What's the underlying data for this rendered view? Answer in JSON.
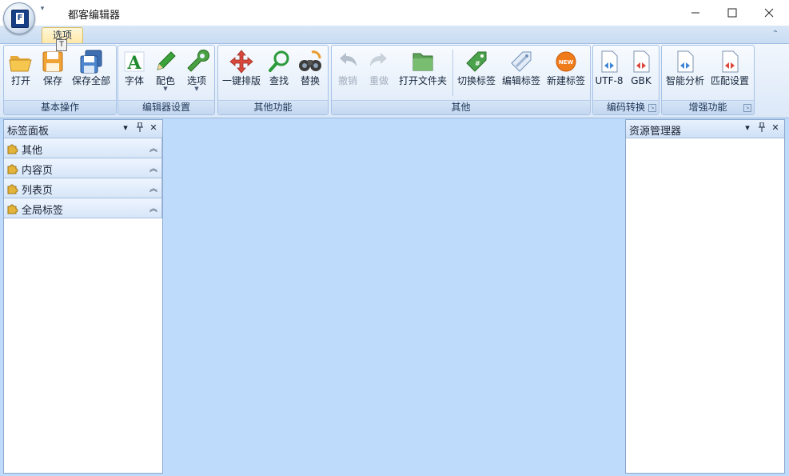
{
  "window": {
    "title": "都客编辑器",
    "minimize_glyph": "—",
    "maximize_glyph": "☐",
    "close_glyph": "✕",
    "app_icon_letter": "F"
  },
  "quick_access": {
    "customize_glyph": "▾"
  },
  "ribbon": {
    "active_tab": "选项",
    "key_tip": "T",
    "collapse_glyph": "⌃",
    "groups": [
      {
        "label": "基本操作",
        "buttons": [
          {
            "label": "打开",
            "icon": "folder-open-icon"
          },
          {
            "label": "保存",
            "icon": "save-icon"
          },
          {
            "label": "保存全部",
            "icon": "save-all-icon"
          }
        ]
      },
      {
        "label": "编辑器设置",
        "buttons": [
          {
            "label": "字体",
            "icon": "font-icon"
          },
          {
            "label": "配色",
            "icon": "pencil-icon",
            "dropdown": true
          },
          {
            "label": "选项",
            "icon": "wrench-icon",
            "dropdown": true
          }
        ]
      },
      {
        "label": "其他功能",
        "buttons": [
          {
            "label": "一键排版",
            "icon": "move-arrows-icon"
          },
          {
            "label": "查找",
            "icon": "magnifier-icon"
          },
          {
            "label": "替换",
            "icon": "binoculars-icon"
          }
        ]
      },
      {
        "label": "其他",
        "buttons": [
          {
            "label": "撤销",
            "icon": "undo-icon",
            "disabled": true
          },
          {
            "label": "重做",
            "icon": "redo-icon",
            "disabled": true
          },
          {
            "label": "打开文件夹",
            "icon": "green-folder-icon"
          },
          {
            "label": "切换标签",
            "icon": "green-tag-icon"
          },
          {
            "label": "编辑标签",
            "icon": "blue-tag-icon"
          },
          {
            "label": "新建标签",
            "icon": "new-badge-icon",
            "badge_text": "NEW"
          }
        ]
      },
      {
        "label": "编码转换",
        "buttons": [
          {
            "label": "UTF-8",
            "icon": "utf8-doc-icon"
          },
          {
            "label": "GBK",
            "icon": "gbk-doc-icon"
          }
        ]
      },
      {
        "label": "增强功能",
        "buttons": [
          {
            "label": "智能分析",
            "icon": "analyze-doc-icon"
          },
          {
            "label": "匹配设置",
            "icon": "match-doc-icon"
          }
        ]
      }
    ]
  },
  "tag_panel": {
    "title": "标签面板",
    "sections": [
      "其他",
      "内容页",
      "列表页",
      "全局标签"
    ]
  },
  "resource_panel": {
    "title": "资源管理器"
  },
  "panel_controls": {
    "menu": "▾",
    "pin": "ᚚ",
    "close": "✕",
    "section_chevron": "⌃"
  },
  "colors": {
    "workspace": "#bfdbfb",
    "ribbon_tab_active": "#ffe7a6",
    "panel_header": "#cfe0f5",
    "panel_border": "#8ca8cc"
  }
}
